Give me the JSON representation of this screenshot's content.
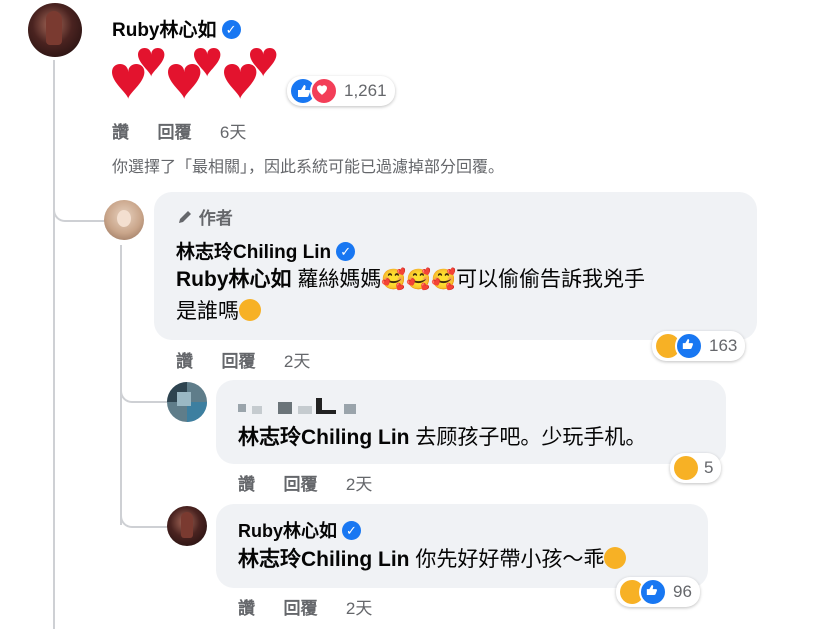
{
  "root_comment": {
    "author": "Ruby林心如",
    "reaction_count": "1,261",
    "like_label": "讚",
    "reply_label": "回覆",
    "time": "6天"
  },
  "filter_notice": "你選擇了「最相關」，因此系統可能已過濾掉部分回覆。",
  "reply1": {
    "author_badge": "作者",
    "author": "林志玲Chiling Lin",
    "mention": "Ruby林心如",
    "text_part1": "蘿絲媽媽",
    "text_part2": "可以偷偷告訴我兇手",
    "text_part3": "是誰嗎",
    "reaction_count": "163",
    "like_label": "讚",
    "reply_label": "回覆",
    "time": "2天"
  },
  "reply2": {
    "author": "",
    "mention": "林志玲Chiling Lin",
    "text": "去顾孩子吧。少玩手机。",
    "reaction_count": "5",
    "like_label": "讚",
    "reply_label": "回覆",
    "time": "2天"
  },
  "reply3": {
    "author": "Ruby林心如",
    "mention": "林志玲Chiling Lin",
    "text": "你先好好帶小孩～乖",
    "reaction_count": "96",
    "like_label": "讚",
    "reply_label": "回覆",
    "time": "2天"
  },
  "colors": {
    "facebook_blue": "#1877f2",
    "love_red": "#f33e58",
    "haha_yellow": "#f7b125",
    "bubble_gray": "#f0f2f5",
    "secondary_text": "#65676b"
  },
  "icons": [
    "verified-badge-icon",
    "heart-icon",
    "like-icon",
    "love-icon",
    "haha-icon",
    "pen-icon",
    "blush-emoji-icon"
  ]
}
